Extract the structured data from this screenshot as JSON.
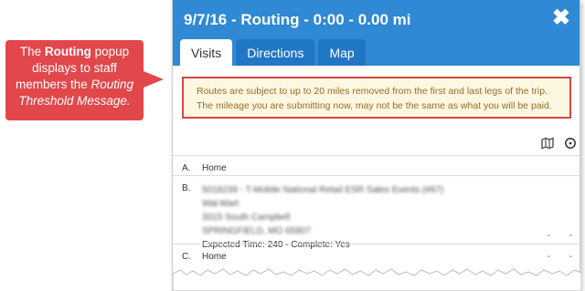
{
  "callout": {
    "pre": "The ",
    "bold": "Routing",
    "mid": " popup displays to staff members the ",
    "italic": "Routing Threshold Message."
  },
  "popup": {
    "title": "9/7/16 - Routing - 0:00 - 0.00 mi",
    "close_label": "✖",
    "tabs": [
      {
        "label": "Visits",
        "active": true
      },
      {
        "label": "Directions",
        "active": false
      },
      {
        "label": "Map",
        "active": false
      }
    ],
    "notice": "Routes are subject to up to 20 miles removed from the first and last legs of the trip. The mileage you are submitting now, may not be the same as what you will be paid.",
    "toolbar_icons": [
      "map-icon",
      "clock-icon"
    ],
    "visits": [
      {
        "letter": "A.",
        "name": "Home"
      },
      {
        "letter": "B.",
        "lines": [
          "5018239 - T-Mobile National Retail ESR Sales Events (#67)",
          "Wal-Mart",
          "3315 South Campbell",
          "SPRINGFIELD, MO 65807"
        ],
        "detail": "Expected Time: 240 - Complete: Yes",
        "dash1": "-",
        "dash2": "-"
      },
      {
        "letter": "C.",
        "name": "Home",
        "dash1": "-",
        "dash2": "-"
      }
    ]
  },
  "colors": {
    "header": "#2f89d4",
    "tab_inactive": "#2276c6",
    "callout": "#e2474b",
    "notice_bg": "#fcf7e0",
    "notice_border": "#d94546",
    "notice_text": "#9a6c28"
  }
}
